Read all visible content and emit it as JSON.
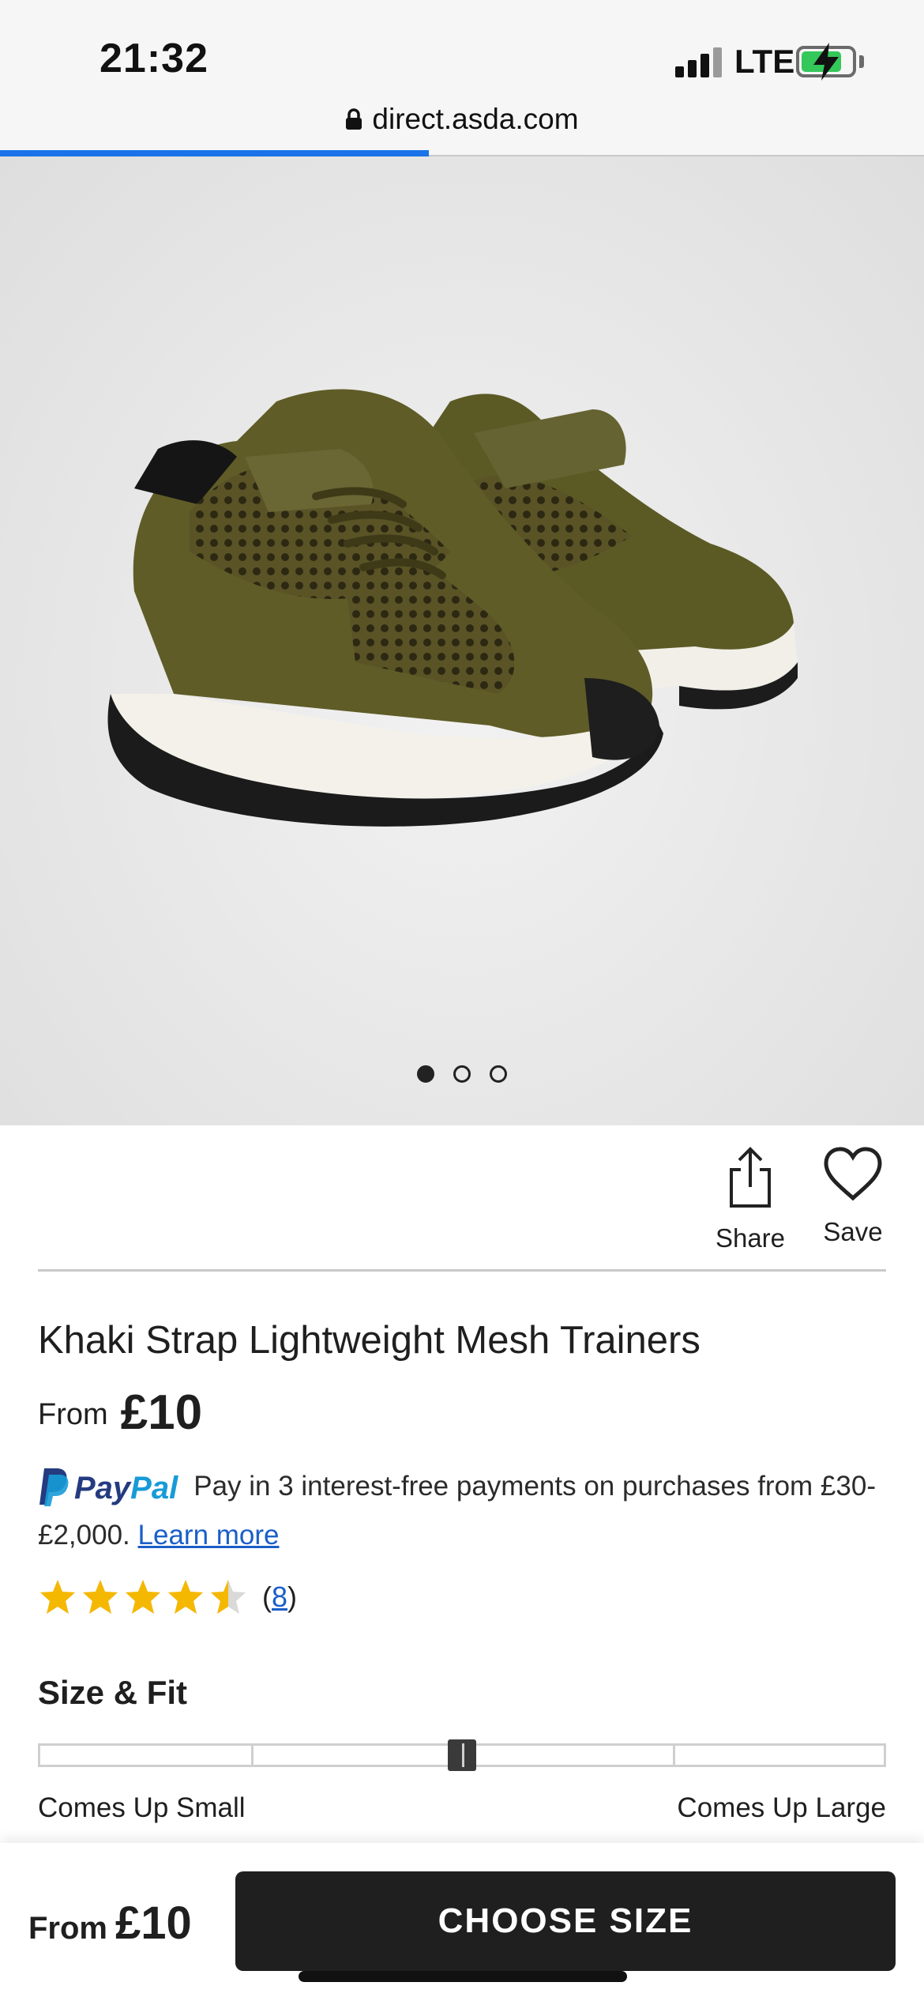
{
  "status_bar": {
    "time": "21:32",
    "network": "LTE",
    "battery_level": 0.8,
    "battery_charging": true,
    "icons": [
      "signal-icon",
      "battery-icon"
    ]
  },
  "browser": {
    "url": "direct.asda.com",
    "load_progress": 0.4,
    "icons": [
      "lock-icon"
    ]
  },
  "gallery": {
    "image_count": 3,
    "active_index": 0,
    "image": "khaki-trainers-photo"
  },
  "actions": {
    "share_label": "Share",
    "save_label": "Save"
  },
  "product": {
    "title": "Khaki Strap Lightweight Mesh Trainers",
    "price_prefix": "From",
    "price": "£10"
  },
  "paypal": {
    "brand_pay": "Pay",
    "brand_pal": "Pal",
    "message": "Pay in 3 interest-free payments on purchases from £30-£2,000.",
    "learn_more": "Learn more"
  },
  "rating": {
    "stars": 4.5,
    "max_stars": 5,
    "review_count": "8",
    "open_paren": "(",
    "close_paren": ")"
  },
  "size_fit": {
    "title": "Size & Fit",
    "segments": 4,
    "position": 0.5,
    "label_small": "Comes Up Small",
    "label_large": "Comes Up Large"
  },
  "bottom_bar": {
    "price_prefix": "From",
    "price": "£10",
    "button_label": "CHOOSE SIZE"
  },
  "colors": {
    "accent_blue": "#1a73e8",
    "link_blue": "#1a5fc8",
    "star_gold": "#f5b800",
    "button_dark": "#1f1f1f",
    "paypal_dark": "#253b80",
    "paypal_light": "#179bd7"
  }
}
